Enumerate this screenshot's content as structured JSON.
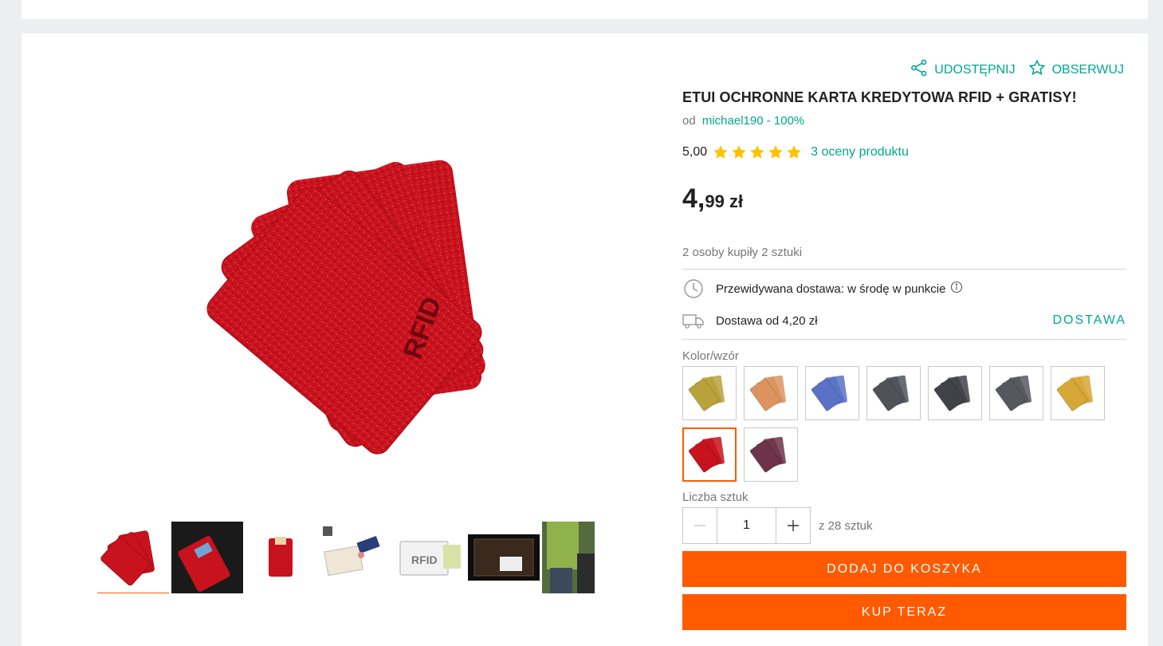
{
  "actions": {
    "share_label": "UDOSTĘPNIJ",
    "watch_label": "OBSERWUJ"
  },
  "product": {
    "title": "ETUI OCHRONNE KARTA KREDYTOWA RFID + GRATISY!",
    "seller_prefix": "od",
    "seller": "michael190 - 100%",
    "rating_value": "5,00",
    "stars": 5,
    "rating_link": "3 oceny produktu",
    "price_int": "4,",
    "price_rest": "99 zł",
    "buyers": "2 osoby kupiły 2 sztuki"
  },
  "delivery": {
    "expected": "Przewidywana dostawa: w środę w punkcie",
    "from": "Dostawa od 4,20 zł",
    "link": "DOSTAWA"
  },
  "variants": {
    "label": "Kolor/wzór",
    "items": [
      {
        "color": "#b9a23a"
      },
      {
        "color": "#dc935f"
      },
      {
        "color": "#5a72c6"
      },
      {
        "color": "#4f5258"
      },
      {
        "color": "#3f4247"
      },
      {
        "color": "#55585e"
      },
      {
        "color": "#d6a735"
      },
      {
        "color": "#c8121d",
        "selected": true
      },
      {
        "color": "#6e3348"
      }
    ]
  },
  "quantity": {
    "label": "Liczba sztuk",
    "value": "1",
    "of": "z 28 sztuk"
  },
  "buttons": {
    "add_to_cart": "DODAJ DO KOSZYKA",
    "buy_now": "KUP TERAZ"
  },
  "main_image": {
    "text": "RFID"
  },
  "colors": {
    "accent": "#00a790",
    "cta": "#ff5a00",
    "star": "#ffc200",
    "card_red": "#c8121d"
  }
}
